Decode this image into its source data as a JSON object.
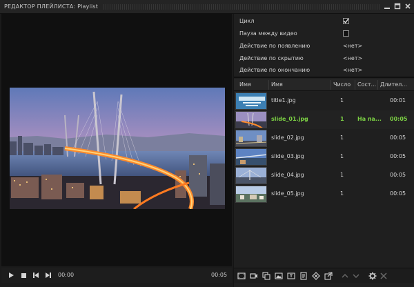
{
  "window": {
    "title": "РЕДАКТОР ПЛЕЙЛИСТА: Playlist"
  },
  "player": {
    "current_time": "00:00",
    "total_time": "00:05"
  },
  "properties": {
    "loop_label": "Цикл",
    "loop_checked": true,
    "pause_label": "Пауза между видео",
    "pause_checked": false,
    "on_show_label": "Действие по появлению",
    "on_show_value": "<нет>",
    "on_hide_label": "Действие по скрытию",
    "on_hide_value": "<нет>",
    "on_end_label": "Действие по окончанию",
    "on_end_value": "<нет>"
  },
  "table": {
    "headers": [
      "Имя",
      "Имя",
      "Число",
      "Сост...",
      "Длител..."
    ],
    "rows": [
      {
        "name": "title1.jpg",
        "count": "1",
        "state": "",
        "duration": "00:01",
        "thumb": "title"
      },
      {
        "name": "slide_01.jpg",
        "count": "1",
        "state": "На па...",
        "duration": "00:05",
        "thumb": "bridge",
        "active": true
      },
      {
        "name": "slide_02.jpg",
        "count": "1",
        "state": "",
        "duration": "00:05",
        "thumb": "city"
      },
      {
        "name": "slide_03.jpg",
        "count": "1",
        "state": "",
        "duration": "00:05",
        "thumb": "harbor"
      },
      {
        "name": "slide_04.jpg",
        "count": "1",
        "state": "",
        "duration": "00:05",
        "thumb": "bridge"
      },
      {
        "name": "slide_05.jpg",
        "count": "1",
        "state": "",
        "duration": "00:05",
        "thumb": "panorama"
      }
    ]
  },
  "colors": {
    "active_text": "#7cd144",
    "background": "#1b1b1b"
  }
}
